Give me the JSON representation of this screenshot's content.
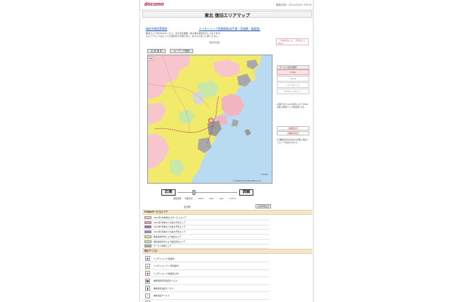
{
  "header": {
    "logo": "docomo",
    "updated": "更新日時：2011/03/21 19:00",
    "title": "東北 復旧エリアマップ"
  },
  "links": {
    "free_charging": "無料充電設置場所",
    "docomo_shop": "ドコモショップ営業情報(岩手県・宮城県・福島県)"
  },
  "notes": {
    "line1": "復旧エリアはFOMAサービス、及び応急移動・拡大等の復旧を示しております。",
    "line2": "※エリアマップはエリアの目安を示す物であり、あらかじめご了承ください。",
    "line3": "【表示方法】",
    "side": "「つながる」に、できることから。"
  },
  "tabs": {
    "wide": "広 域 選 択",
    "keyword": "キーワード検索"
  },
  "map": {
    "credit": "© Shobunsha Publications, Inc.",
    "scale": "1:50km"
  },
  "rightpanel": {
    "service_head": "サービス表示選択",
    "buttons": [
      "FOMA",
      "mova",
      "ハイスピード",
      "Xi/ITCコンセット"
    ],
    "note": "※選択されたものの黄色いまで FOMA対象の状態をリング確認頂けます。",
    "all_show": "全機能表示",
    "all_hide": "全機能非表示",
    "note2": "※全機能表示時は表示の状態は 特定カテゴリーが表示されます。"
  },
  "zoom": {
    "wide": "広域",
    "detail": "詳細",
    "levels": [
      "都道府県",
      "市区町村",
      "35km",
      "8km",
      "4km",
      "1.5km"
    ]
  },
  "legend": {
    "title": "【凡例】",
    "print": "凡例印刷表示",
    "foma_head": "FOMAサービスエリア",
    "foma_items": [
      {
        "label": "2011年3月末時点 のサービスエリア",
        "color": "#f6c1c7"
      },
      {
        "label": "2011年3月末までの拡大予定エリア",
        "color": "#e98fb0"
      },
      {
        "label": "2011年3月末までの拡大予定エリア",
        "color": "#a75cb0"
      },
      {
        "label": "2011年4月末までの拡大予定エリア",
        "color": "#9b7fc7"
      },
      {
        "label": "移動基地局車により復旧エリア",
        "color": "#e6ea6b"
      },
      {
        "label": "移動基地局車により復旧済みエリア",
        "color": "#c8e8a8"
      },
      {
        "label": "サービス中断エリア",
        "color": "#a8a8a8"
      }
    ],
    "icon_head": "表示アイコン",
    "icon_items": [
      {
        "label": "ドコモショップ(営業中)",
        "icon": "shop-open-icon"
      },
      {
        "label": "ドコモショップ(一部営業中)",
        "icon": "shop-partial-icon"
      },
      {
        "label": "ドコモショップ(営業停止中)",
        "icon": "shop-closed-icon"
      },
      {
        "label": "無料衛星携帯電話サービス",
        "icon": "satellite-phone-icon"
      },
      {
        "label": "無料携帯電話サービス",
        "icon": "mobile-phone-icon"
      },
      {
        "label": "無料充電サービス",
        "icon": "charging-icon"
      },
      {
        "label": "伝統衛星携帯",
        "icon": "antenna-icon"
      }
    ]
  }
}
